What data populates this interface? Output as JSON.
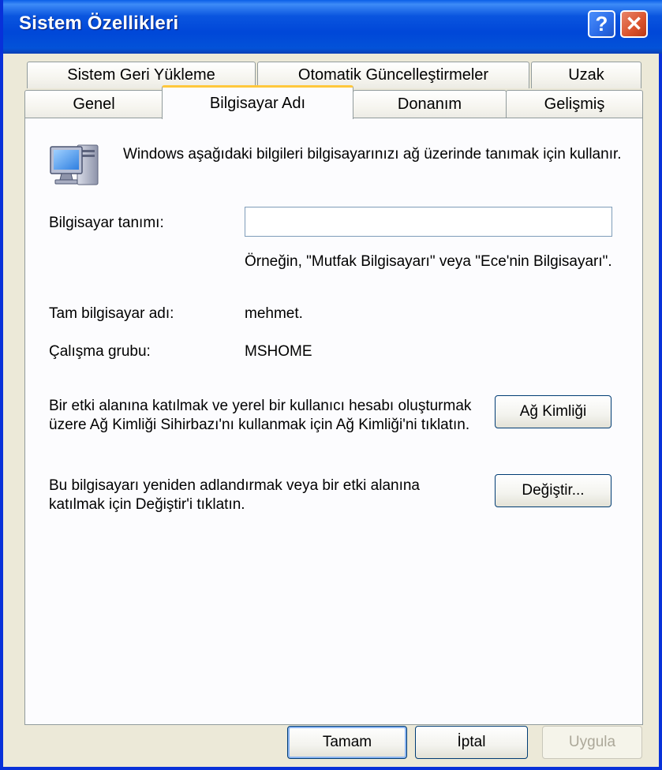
{
  "window": {
    "title": "Sistem Özellikleri",
    "help_glyph": "?",
    "close_glyph": "✕"
  },
  "tabs": {
    "row1": [
      "Sistem Geri Yükleme",
      "Otomatik Güncelleştirmeler",
      "Uzak"
    ],
    "row2": [
      "Genel",
      "Bilgisayar Adı",
      "Donanım",
      "Gelişmiş"
    ],
    "active": "Bilgisayar Adı"
  },
  "content": {
    "intro": "Windows aşağıdaki bilgileri bilgisayarınızı ağ üzerinde tanımak için kullanır.",
    "description_label": "Bilgisayar tanımı:",
    "description_value": "",
    "description_hint": "Örneğin, \"Mutfak Bilgisayarı\" veya \"Ece'nin Bilgisayarı\".",
    "full_name_label": "Tam bilgisayar adı:",
    "full_name_value": "mehmet.",
    "workgroup_label": "Çalışma grubu:",
    "workgroup_value": "MSHOME",
    "network_id_text": "Bir etki alanına katılmak ve yerel bir kullanıcı hesabı oluşturmak üzere Ağ Kimliği Sihirbazı'nı kullanmak için Ağ Kimliği'ni tıklatın.",
    "network_id_button": "Ağ Kimliği",
    "rename_text": "Bu bilgisayarı yeniden adlandırmak veya bir etki alanına katılmak için Değiştir'i tıklatın.",
    "change_button": "Değiştir..."
  },
  "footer": {
    "ok": "Tamam",
    "cancel": "İptal",
    "apply": "Uygula"
  },
  "icons": {
    "computer": "computer-icon"
  },
  "colors": {
    "titlebar": "#0A55DF",
    "dialog_bg": "#ECE9D8",
    "active_tab_accent": "#FFC83C",
    "disabled_text": "#ACA899"
  }
}
